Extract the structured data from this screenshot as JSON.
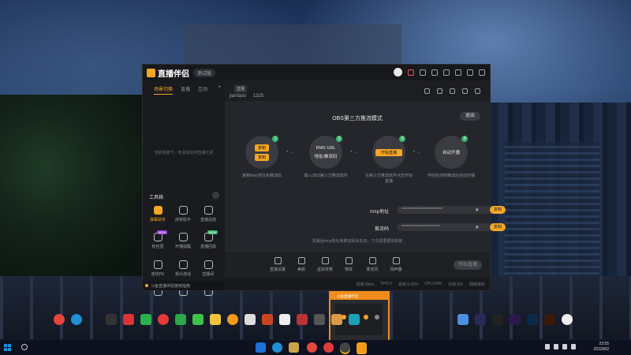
{
  "app": {
    "brand": "直播伴侣",
    "version_chip": "测试版",
    "left_tabs": [
      "场景切换",
      "直播",
      "互动"
    ],
    "empty_message": "当前场景下，未添加任何直播元素",
    "tools_title": "工具箱",
    "tools": [
      {
        "label": "弹幕助手",
        "badge": "",
        "active": true
      },
      {
        "label": "房管助手",
        "badge": "",
        "active": false
      },
      {
        "label": "直播总结",
        "badge": "",
        "active": false
      },
      {
        "label": "粉丝团",
        "badge": "NEW",
        "active": false
      },
      {
        "label": "开播提醒",
        "badge": "",
        "active": false
      },
      {
        "label": "直播回放",
        "badge": "NEW",
        "active": false
      },
      {
        "label": "连线PK",
        "badge": "",
        "active": false
      },
      {
        "label": "观众连线",
        "badge": "",
        "active": false
      },
      {
        "label": "直播间",
        "badge": "",
        "active": false
      },
      {
        "label": "直播宝盒",
        "badge": "",
        "active": false
      },
      {
        "label": "更多",
        "badge": "NEW",
        "active": false
      },
      {
        "label": "更多",
        "badge": "",
        "active": false
      }
    ],
    "notice": "斗鱼直播伴侣使用指南",
    "main_tag": "直播",
    "streamer_name": "jianfadu",
    "viewer_count": "1325",
    "mode_title": "OBS第三方推流模式",
    "exit_label": "退出",
    "steps": [
      {
        "num": "1",
        "lines": [
          "复制",
          "复制"
        ],
        "caption": "复制rtmp地址和推流码"
      },
      {
        "num": "2",
        "lines": [
          "RMS URL",
          "地址/推流码"
        ],
        "caption": "填入OBS第三方推流软件"
      },
      {
        "num": "3",
        "lines": [
          "开始直播"
        ],
        "caption": "在第三方推流软件点击开始直播"
      },
      {
        "num": "4",
        "lines": [
          "自动开播"
        ],
        "caption": "伴侣检测到推流后自动开播"
      }
    ],
    "rtmp_label": "rtmp地址",
    "rtmp_value": "***************************",
    "key_label": "推流码",
    "key_value": "*************************",
    "copy_label": "复制",
    "hint": "关播后rtmp地址和推流码会失效，下次需要重新获取",
    "toolbar": [
      "直播设置",
      "美颜",
      "虚拟背景",
      "特效",
      "麦克风",
      "扬声器"
    ],
    "start_label": "开始直播",
    "status": [
      "码率:0kb/s",
      "FPS:0",
      "丢帧:0.00%",
      "CPU:24%",
      "内存:0%",
      "网络良好"
    ]
  },
  "mini_window": {
    "title": "斗鱼直播伴侣"
  },
  "taskbar": {
    "time": "23:55",
    "date": "2022/8/2"
  },
  "colors": {
    "accent": "#f5a623",
    "green": "#3cb371"
  }
}
